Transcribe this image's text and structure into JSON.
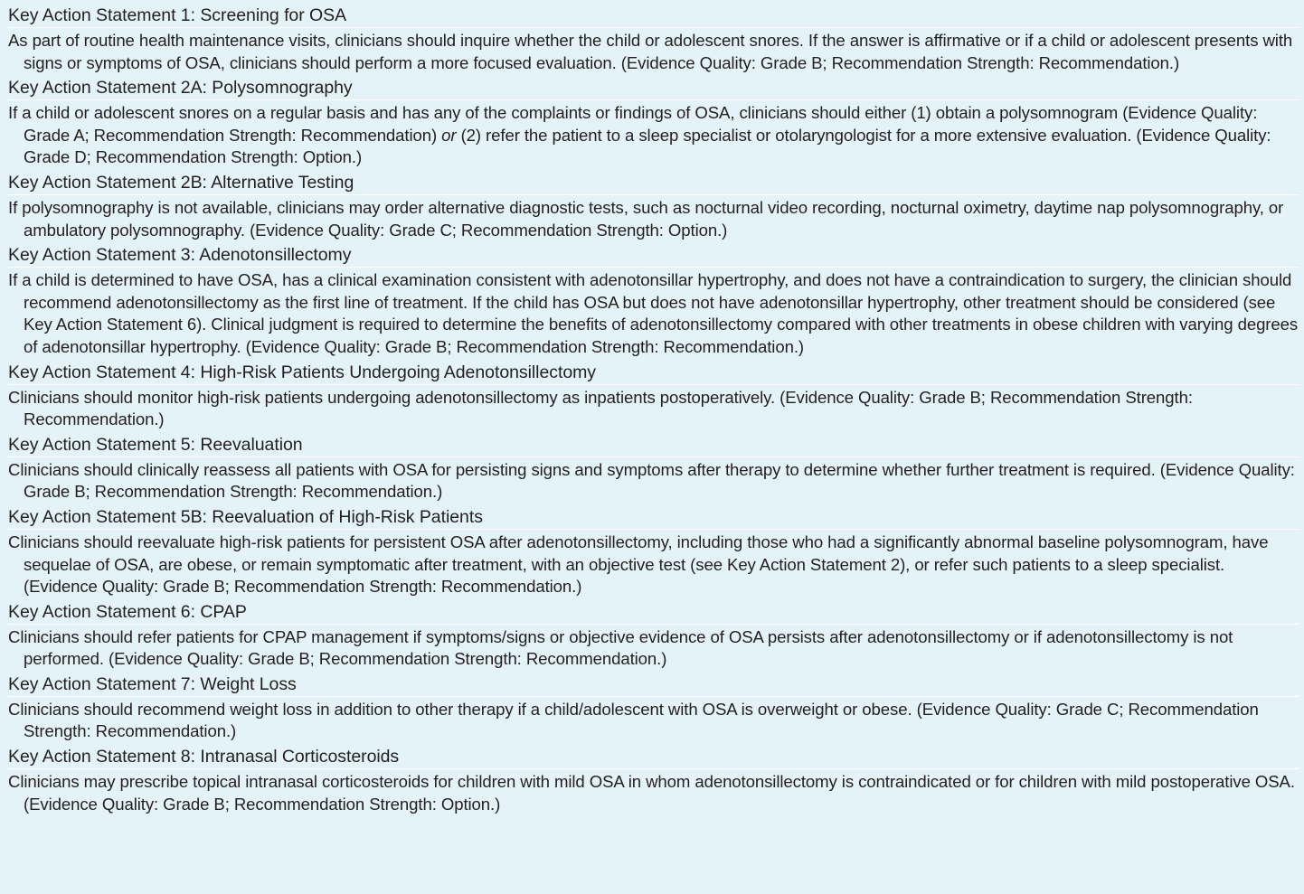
{
  "statements": [
    {
      "title": "Key Action Statement 1: Screening for OSA",
      "body": "As part of routine health maintenance visits, clinicians should inquire whether the child or adolescent snores. If the answer is affirmative or if a child or adolescent presents with signs or symptoms of OSA, clinicians should perform a more focused evaluation. (Evidence Quality: Grade B; Recommendation Strength: Recommendation.)"
    },
    {
      "title": "Key Action Statement 2A: Polysomnography",
      "body_part1": "If a child or adolescent snores on a regular basis and has any of the complaints or findings of OSA, clinicians should either (1) obtain a polysomnogram (Evidence Quality: Grade A; Recommendation Strength: Recommendation) ",
      "body_emphasis": "or",
      "body_part2": " (2) refer the patient to a sleep specialist or otolaryngologist for a more extensive evaluation. (Evidence Quality: Grade D; Recommendation Strength: Option.)"
    },
    {
      "title": "Key Action Statement 2B: Alternative Testing",
      "body": "If polysomnography is not available, clinicians may order alternative diagnostic tests, such as nocturnal video recording, nocturnal oximetry, daytime nap polysomnography, or ambulatory polysomnography. (Evidence Quality: Grade C; Recommendation Strength: Option.)"
    },
    {
      "title": "Key Action Statement 3: Adenotonsillectomy",
      "body": "If a child is determined to have OSA, has a clinical examination consistent with adenotonsillar hypertrophy, and does not have a contraindication to surgery, the clinician should recommend adenotonsillectomy as the first line of treatment. If the child has OSA but does not have adenotonsillar hypertrophy, other treatment should be considered (see Key Action Statement 6). Clinical judgment is required to determine the benefits of adenotonsillectomy compared with other treatments in obese children with varying degrees of adenotonsillar hypertrophy. (Evidence Quality: Grade B; Recommendation Strength: Recommendation.)"
    },
    {
      "title": "Key Action Statement 4: High-Risk Patients Undergoing Adenotonsillectomy",
      "body": "Clinicians should monitor high-risk patients undergoing adenotonsillectomy as inpatients postoperatively. (Evidence Quality: Grade B; Recommendation Strength: Recommendation.)"
    },
    {
      "title": "Key Action Statement 5: Reevaluation",
      "body": "Clinicians should clinically reassess all patients with OSA for persisting signs and symptoms after therapy to determine whether further treatment is required. (Evidence Quality: Grade B; Recommendation Strength: Recommendation.)"
    },
    {
      "title": "Key Action Statement 5B: Reevaluation of High-Risk Patients",
      "body": "Clinicians should reevaluate high-risk patients for persistent OSA after adenotonsillectomy, including those who had a significantly abnormal baseline polysomnogram, have sequelae of OSA, are obese, or remain symptomatic after treatment, with an objective test (see Key Action Statement 2), or refer such patients to a sleep specialist. (Evidence Quality: Grade B; Recommendation Strength: Recommendation.)"
    },
    {
      "title": "Key Action Statement 6: CPAP",
      "body": "Clinicians should refer patients for CPAP management if symptoms/signs or objective evidence of OSA persists after adenotonsillectomy or if adenotonsillectomy is not performed. (Evidence Quality: Grade B; Recommendation Strength: Recommendation.)"
    },
    {
      "title": "Key Action Statement 7: Weight Loss",
      "body": "Clinicians should recommend weight loss in addition to other therapy if a child/adolescent with OSA is overweight or obese. (Evidence Quality: Grade C; Recommendation Strength: Recommendation.)"
    },
    {
      "title": "Key Action Statement 8: Intranasal Corticosteroids",
      "body": "Clinicians may prescribe topical intranasal corticosteroids for children with mild OSA in whom adenotonsillectomy is contraindicated or for children with mild postoperative OSA. (Evidence Quality: Grade B; Recommendation Strength: Option.)"
    }
  ]
}
